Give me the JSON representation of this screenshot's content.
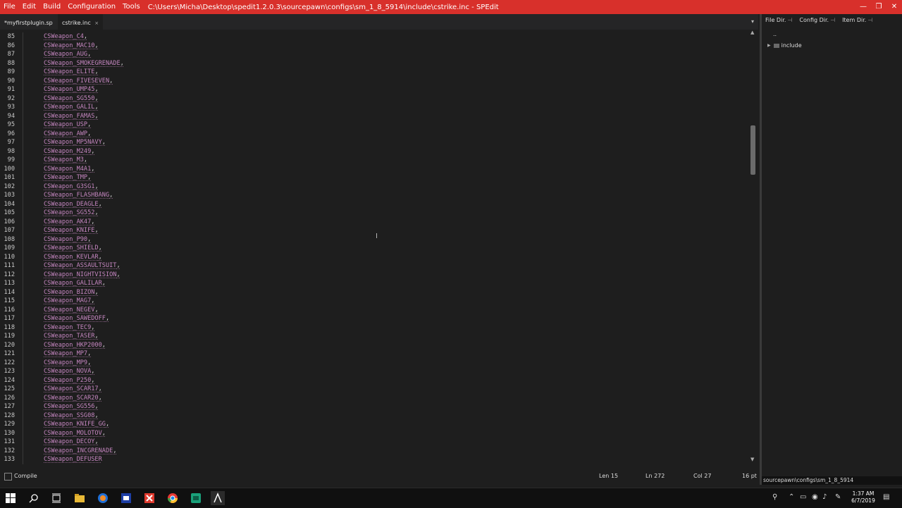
{
  "menu": [
    "File",
    "Edit",
    "Build",
    "Configuration",
    "Tools"
  ],
  "window_title": "C:\\Users\\Micha\\Desktop\\spedit1.2.0.3\\sourcepawn\\configs\\sm_1_8_5914\\include\\cstrike.inc - SPEdit",
  "window_controls": {
    "minimize": "—",
    "restore": "❐",
    "close": "✕"
  },
  "tabs": [
    {
      "label": "*myfirstplugin.sp",
      "active": false
    },
    {
      "label": "cstrike.inc",
      "close": "×",
      "active": true
    }
  ],
  "tab_menu_glyph": "▾",
  "code_lines": [
    {
      "num": "85",
      "name": "CSWeapon_C4",
      "punct": ","
    },
    {
      "num": "86",
      "name": "CSWeapon_MAC10",
      "punct": ","
    },
    {
      "num": "87",
      "name": "CSWeapon_AUG",
      "punct": ","
    },
    {
      "num": "88",
      "name": "CSWeapon_SMOKEGRENADE",
      "punct": ","
    },
    {
      "num": "89",
      "name": "CSWeapon_ELITE",
      "punct": ","
    },
    {
      "num": "90",
      "name": "CSWeapon_FIVESEVEN",
      "punct": ","
    },
    {
      "num": "91",
      "name": "CSWeapon_UMP45",
      "punct": ","
    },
    {
      "num": "92",
      "name": "CSWeapon_SG550",
      "punct": ","
    },
    {
      "num": "93",
      "name": "CSWeapon_GALIL",
      "punct": ","
    },
    {
      "num": "94",
      "name": "CSWeapon_FAMAS",
      "punct": ","
    },
    {
      "num": "95",
      "name": "CSWeapon_USP",
      "punct": ","
    },
    {
      "num": "96",
      "name": "CSWeapon_AWP",
      "punct": ","
    },
    {
      "num": "97",
      "name": "CSWeapon_MP5NAVY",
      "punct": ","
    },
    {
      "num": "98",
      "name": "CSWeapon_M249",
      "punct": ","
    },
    {
      "num": "99",
      "name": "CSWeapon_M3",
      "punct": ","
    },
    {
      "num": "100",
      "name": "CSWeapon_M4A1",
      "punct": ","
    },
    {
      "num": "101",
      "name": "CSWeapon_TMP",
      "punct": ","
    },
    {
      "num": "102",
      "name": "CSWeapon_G3SG1",
      "punct": ","
    },
    {
      "num": "103",
      "name": "CSWeapon_FLASHBANG",
      "punct": ","
    },
    {
      "num": "104",
      "name": "CSWeapon_DEAGLE",
      "punct": ","
    },
    {
      "num": "105",
      "name": "CSWeapon_SG552",
      "punct": ","
    },
    {
      "num": "106",
      "name": "CSWeapon_AK47",
      "punct": ","
    },
    {
      "num": "107",
      "name": "CSWeapon_KNIFE",
      "punct": ","
    },
    {
      "num": "108",
      "name": "CSWeapon_P90",
      "punct": ","
    },
    {
      "num": "109",
      "name": "CSWeapon_SHIELD",
      "punct": ","
    },
    {
      "num": "110",
      "name": "CSWeapon_KEVLAR",
      "punct": ","
    },
    {
      "num": "111",
      "name": "CSWeapon_ASSAULTSUIT",
      "punct": ","
    },
    {
      "num": "112",
      "name": "CSWeapon_NIGHTVISION",
      "punct": ","
    },
    {
      "num": "113",
      "name": "CSWeapon_GALILAR",
      "punct": ","
    },
    {
      "num": "114",
      "name": "CSWeapon_BIZON",
      "punct": ","
    },
    {
      "num": "115",
      "name": "CSWeapon_MAG7",
      "punct": ","
    },
    {
      "num": "116",
      "name": "CSWeapon_NEGEV",
      "punct": ","
    },
    {
      "num": "117",
      "name": "CSWeapon_SAWEDOFF",
      "punct": ","
    },
    {
      "num": "118",
      "name": "CSWeapon_TEC9",
      "punct": ","
    },
    {
      "num": "119",
      "name": "CSWeapon_TASER",
      "punct": ","
    },
    {
      "num": "120",
      "name": "CSWeapon_HKP2000",
      "punct": ","
    },
    {
      "num": "121",
      "name": "CSWeapon_MP7",
      "punct": ","
    },
    {
      "num": "122",
      "name": "CSWeapon_MP9",
      "punct": ","
    },
    {
      "num": "123",
      "name": "CSWeapon_NOVA",
      "punct": ","
    },
    {
      "num": "124",
      "name": "CSWeapon_P250",
      "punct": ","
    },
    {
      "num": "125",
      "name": "CSWeapon_SCAR17",
      "punct": ","
    },
    {
      "num": "126",
      "name": "CSWeapon_SCAR20",
      "punct": ","
    },
    {
      "num": "127",
      "name": "CSWeapon_SG556",
      "punct": ","
    },
    {
      "num": "128",
      "name": "CSWeapon_SSG08",
      "punct": ","
    },
    {
      "num": "129",
      "name": "CSWeapon_KNIFE_GG",
      "punct": ","
    },
    {
      "num": "130",
      "name": "CSWeapon_MOLOTOV",
      "punct": ","
    },
    {
      "num": "131",
      "name": "CSWeapon_DECOY",
      "punct": ","
    },
    {
      "num": "132",
      "name": "CSWeapon_INCGRENADE",
      "punct": ","
    },
    {
      "num": "133",
      "name": "CSWeapon_DEFUSER",
      "punct": ""
    }
  ],
  "right_panel": {
    "tabs": [
      "File Dir.",
      "Config Dir.",
      "Item Dir."
    ],
    "pin_glyph": "⊣",
    "tree_up": "..",
    "tree_items": [
      "include"
    ],
    "path": "sourcepawn\\configs\\sm_1_8_5914"
  },
  "status": {
    "compile_label": "Compile",
    "len": "Len 15",
    "ln": "Ln 272",
    "col": "Col 27",
    "font_size": "16 pt"
  },
  "clock": {
    "time": "1:37 AM",
    "date": "6/7/2019"
  },
  "colors": {
    "titlebar": "#d8302b",
    "code_identifier": "#c586c0",
    "background": "#1e1e1e"
  }
}
